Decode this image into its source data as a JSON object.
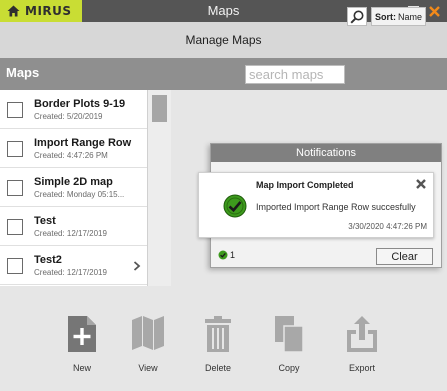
{
  "app": {
    "logo_text": "MIRUS",
    "window_title": "Maps",
    "subtitle": "Manage Maps"
  },
  "window_controls": [
    "minimize",
    "maximize",
    "close"
  ],
  "maps_header": {
    "title": "Maps",
    "search_placeholder": "search maps",
    "sort_label": "Sort:",
    "sort_value": "Name"
  },
  "maps": [
    {
      "name": "Border Plots 9-19",
      "created": "Created: 5/20/2019"
    },
    {
      "name": "Import Range Row",
      "created": "Created: 4:47:26 PM"
    },
    {
      "name": "Simple 2D map",
      "created": "Created: Monday 05:15..."
    },
    {
      "name": "Test",
      "created": "Created: 12/17/2019"
    },
    {
      "name": "Test2",
      "created": "Created: 12/17/2019"
    }
  ],
  "notifications": {
    "header": "Notifications",
    "items": [
      {
        "title": "Map Import Completed",
        "message": "Imported Import Range Row succesfully",
        "time": "3/30/2020 4:47:26 PM"
      }
    ],
    "count": "1",
    "clear_label": "Clear"
  },
  "toolbar": [
    {
      "label": "New",
      "icon": "new-file-icon"
    },
    {
      "label": "View",
      "icon": "map-view-icon"
    },
    {
      "label": "Delete",
      "icon": "trash-icon"
    },
    {
      "label": "Copy",
      "icon": "copy-icon"
    },
    {
      "label": "Export",
      "icon": "export-icon"
    }
  ],
  "colors": {
    "brand": "#c9dd34",
    "titlebar": "#555555",
    "header": "#8f8f8f",
    "success": "#3d9a1d",
    "close_accent": "#f28a1a",
    "icon_gray": "#767676"
  }
}
